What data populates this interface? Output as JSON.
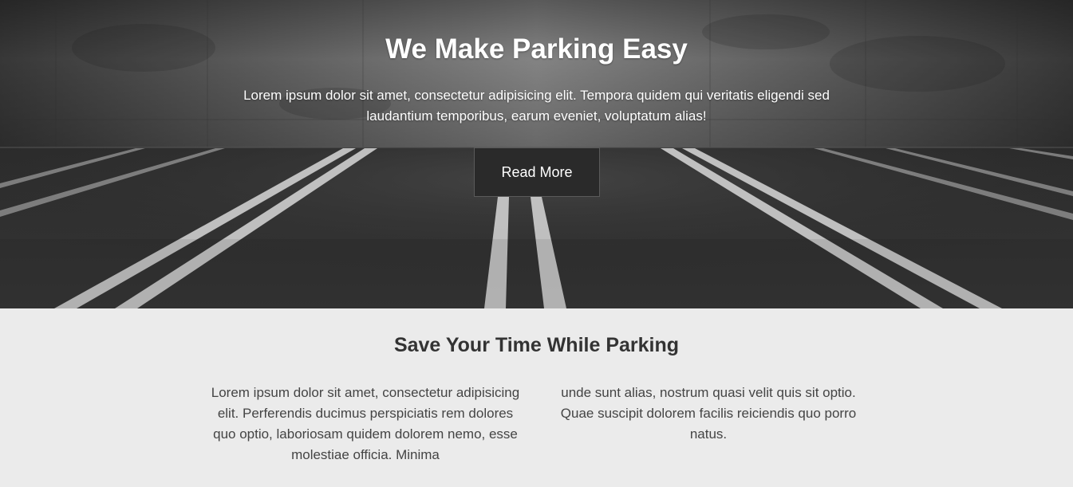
{
  "hero": {
    "title": "We Make Parking Easy",
    "text": "Lorem ipsum dolor sit amet, consectetur adipisicing elit. Tempora quidem qui veritatis eligendi sed laudantium temporibus, earum eveniet, voluptatum alias!",
    "button_label": "Read More"
  },
  "feature": {
    "title": "Save Your Time While Parking",
    "col_left": "Lorem ipsum dolor sit amet, consectetur adipisicing elit. Perferendis ducimus perspiciatis rem dolores quo optio, laboriosam quidem dolorem nemo, esse molestiae officia. Minima",
    "col_right": "unde sunt alias, nostrum quasi velit quis sit optio. Quae suscipit dolorem facilis reiciendis quo porro natus."
  },
  "colors": {
    "hero_dark": "#2e2e2e",
    "button_bg": "#2a2a2a",
    "section_bg": "#ebebeb",
    "heading_text": "#333333"
  }
}
